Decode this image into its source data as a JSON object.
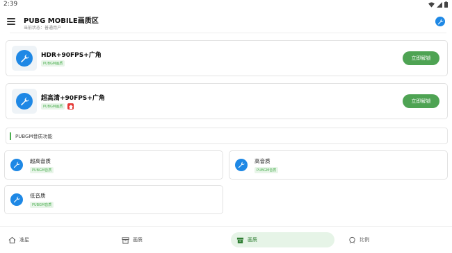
{
  "status_bar": {
    "time": "2:39"
  },
  "app_bar": {
    "title": "PUBG MOBILE画质区",
    "subtitle": "当前状态：普通用户",
    "menu_icon": "menu-icon",
    "action_icon": "wrench-icon"
  },
  "feature_cards": [
    {
      "title": "HDR+90FPS+广角",
      "tags": [
        "PUBGM画质"
      ],
      "button": "立即解锁",
      "hot": false
    },
    {
      "title": "超高清+90FPS+广角",
      "tags": [
        "PUBGM画质"
      ],
      "button": "立即解锁",
      "hot": true
    }
  ],
  "audio_section": {
    "title": "PUBGM音质功能",
    "items": [
      {
        "title": "超高音质",
        "tag": "PUBGM音质"
      },
      {
        "title": "高音质",
        "tag": "PUBGM音质"
      },
      {
        "title": "低音质",
        "tag": "PUBGM音质"
      }
    ]
  },
  "bottom_nav": [
    {
      "label": "准星",
      "icon": "home-icon",
      "active": false
    },
    {
      "label": "画质",
      "icon": "box-icon",
      "active": false
    },
    {
      "label": "画质",
      "icon": "box-icon",
      "active": true
    },
    {
      "label": "比例",
      "icon": "ratio-icon",
      "active": false
    }
  ],
  "colors": {
    "accent_green": "#4ea353",
    "icon_blue": "#1e88e5",
    "hot_red": "#e53935"
  }
}
